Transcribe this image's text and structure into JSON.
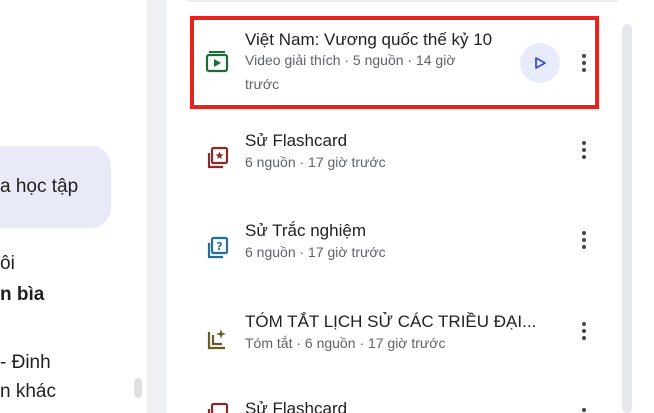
{
  "chat": {
    "fragments": [
      "a học tập",
      "ôi",
      "n bìa",
      "- Đinh",
      "n khác"
    ]
  },
  "studio": {
    "items": [
      {
        "title": "Việt Nam: Vương quốc thế kỷ 10",
        "meta_line1": "Video giải thích · 5 nguồn · 14 giờ",
        "meta_line2": "trước",
        "icon": "video-overview-icon",
        "icon_color": "#1e6b3a",
        "has_play": true
      },
      {
        "title": "Sử Flashcard",
        "meta_line1": "6 nguồn · 17 giờ trước",
        "icon": "flashcard-icon",
        "icon_color": "#8c2a2a"
      },
      {
        "title": "Sử Trắc nghiệm",
        "meta_line1": "6 nguồn · 17 giờ trước",
        "icon": "quiz-icon",
        "icon_color": "#1f6f9e"
      },
      {
        "title": "TÓM TẮT LỊCH SỬ CÁC TRIỀU ĐẠI...",
        "meta_line1": "Tóm tắt · 6 nguồn · 17 giờ trước",
        "icon": "summary-icon",
        "icon_color": "#6b5a2a"
      },
      {
        "title": "Sử Flashcard",
        "icon": "flashcard-icon",
        "icon_color": "#8c2a2a"
      }
    ]
  },
  "colors": {
    "highlight": "#e8231c",
    "play_bg": "#e8ebfa",
    "play_icon": "#3c4cc9"
  }
}
